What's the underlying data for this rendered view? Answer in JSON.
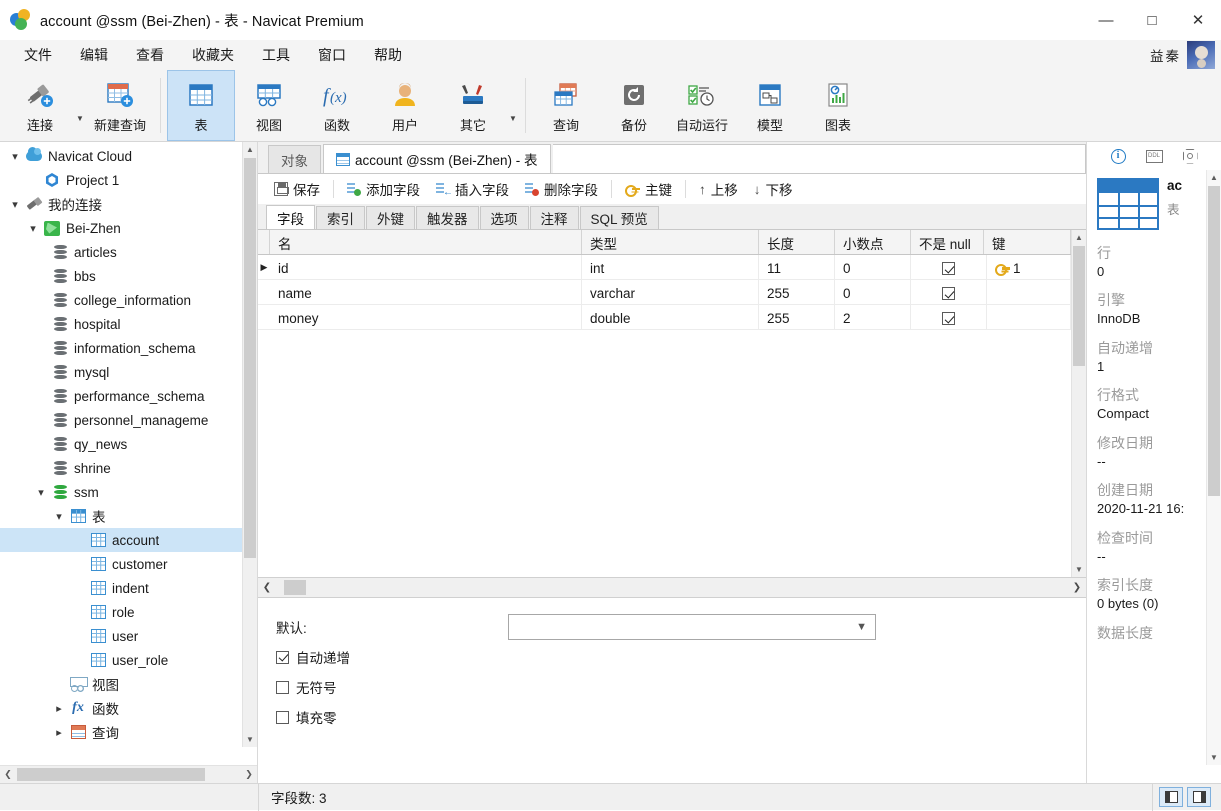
{
  "window": {
    "title": "account @ssm (Bei-Zhen) - 表 - Navicat Premium",
    "minimize": "—",
    "maximize": "□",
    "close": "✕"
  },
  "menubar": {
    "items": [
      "文件",
      "编辑",
      "查看",
      "收藏夹",
      "工具",
      "窗口",
      "帮助"
    ],
    "username": "益秦"
  },
  "ribbon": {
    "buttons": [
      {
        "label": "连接",
        "icon": "connection-icon",
        "caret": true
      },
      {
        "label": "新建查询",
        "icon": "new-query-icon",
        "caret": false
      },
      {
        "label": "表",
        "icon": "table-icon",
        "caret": false,
        "active": true
      },
      {
        "label": "视图",
        "icon": "view-icon",
        "caret": false
      },
      {
        "label": "函数",
        "icon": "function-icon",
        "caret": false
      },
      {
        "label": "用户",
        "icon": "user-icon",
        "caret": false
      },
      {
        "label": "其它",
        "icon": "other-icon",
        "caret": true
      },
      {
        "label": "查询",
        "icon": "query-icon",
        "caret": false
      },
      {
        "label": "备份",
        "icon": "backup-icon",
        "caret": false
      },
      {
        "label": "自动运行",
        "icon": "automation-icon",
        "caret": false
      },
      {
        "label": "模型",
        "icon": "model-icon",
        "caret": false
      },
      {
        "label": "图表",
        "icon": "chart-icon",
        "caret": false
      }
    ]
  },
  "sidebar": {
    "tree": [
      {
        "label": "Navicat Cloud",
        "indent": 0,
        "icon": "cloud-icon",
        "caret": "open"
      },
      {
        "label": "Project 1",
        "indent": 1,
        "icon": "project-icon",
        "caret": "none"
      },
      {
        "label": "我的连接",
        "indent": 0,
        "icon": "plug-icon",
        "caret": "open"
      },
      {
        "label": "Bei-Zhen",
        "indent": 1,
        "icon": "connection-icon",
        "caret": "open"
      },
      {
        "label": "articles",
        "indent": 2,
        "icon": "database-icon",
        "caret": "none"
      },
      {
        "label": "bbs",
        "indent": 2,
        "icon": "database-icon",
        "caret": "none"
      },
      {
        "label": "college_information",
        "indent": 2,
        "icon": "database-icon",
        "caret": "none"
      },
      {
        "label": "hospital",
        "indent": 2,
        "icon": "database-icon",
        "caret": "none"
      },
      {
        "label": "information_schema",
        "indent": 2,
        "icon": "database-icon",
        "caret": "none"
      },
      {
        "label": "mysql",
        "indent": 2,
        "icon": "database-icon",
        "caret": "none"
      },
      {
        "label": "performance_schema",
        "indent": 2,
        "icon": "database-icon",
        "caret": "none"
      },
      {
        "label": "personnel_manageme",
        "indent": 2,
        "icon": "database-icon",
        "caret": "none"
      },
      {
        "label": "qy_news",
        "indent": 2,
        "icon": "database-icon",
        "caret": "none"
      },
      {
        "label": "shrine",
        "indent": 2,
        "icon": "database-icon",
        "caret": "none"
      },
      {
        "label": "ssm",
        "indent": 2,
        "icon": "database-open-icon",
        "caret": "open"
      },
      {
        "label": "表",
        "indent": 3,
        "icon": "table-folder-icon",
        "caret": "open"
      },
      {
        "label": "account",
        "indent": 4,
        "icon": "table-icon",
        "caret": "none",
        "selected": true
      },
      {
        "label": "customer",
        "indent": 4,
        "icon": "table-icon",
        "caret": "none"
      },
      {
        "label": "indent",
        "indent": 4,
        "icon": "table-icon",
        "caret": "none"
      },
      {
        "label": "role",
        "indent": 4,
        "icon": "table-icon",
        "caret": "none"
      },
      {
        "label": "user",
        "indent": 4,
        "icon": "table-icon",
        "caret": "none"
      },
      {
        "label": "user_role",
        "indent": 4,
        "icon": "table-icon",
        "caret": "none"
      },
      {
        "label": "视图",
        "indent": 3,
        "icon": "view-icon",
        "caret": "none"
      },
      {
        "label": "函数",
        "indent": 3,
        "icon": "function-icon",
        "caret": "closed"
      },
      {
        "label": "查询",
        "indent": 3,
        "icon": "query-icon",
        "caret": "closed"
      }
    ]
  },
  "main": {
    "window_tabs": [
      {
        "label": "对象",
        "active": false
      },
      {
        "label": "account @ssm (Bei-Zhen) - 表",
        "active": true,
        "icon": "table-design-icon"
      }
    ],
    "toolbar": [
      {
        "label": "保存",
        "icon": "save-icon"
      },
      {
        "label": "添加字段",
        "icon": "add-field-icon"
      },
      {
        "label": "插入字段",
        "icon": "insert-field-icon"
      },
      {
        "label": "删除字段",
        "icon": "delete-field-icon"
      },
      {
        "label": "主键",
        "icon": "primary-key-icon"
      },
      {
        "label": "上移",
        "icon": "move-up-icon"
      },
      {
        "label": "下移",
        "icon": "move-down-icon"
      }
    ],
    "field_tabs": [
      {
        "label": "字段",
        "active": true
      },
      {
        "label": "索引",
        "active": false
      },
      {
        "label": "外键",
        "active": false
      },
      {
        "label": "触发器",
        "active": false
      },
      {
        "label": "选项",
        "active": false
      },
      {
        "label": "注释",
        "active": false
      },
      {
        "label": "SQL 预览",
        "active": false
      }
    ],
    "grid": {
      "columns": [
        "名",
        "类型",
        "长度",
        "小数点",
        "不是 null",
        "键"
      ],
      "rows": [
        {
          "name": "id",
          "type": "int",
          "length": "11",
          "decimals": "0",
          "not_null": true,
          "key": "1",
          "current": true
        },
        {
          "name": "name",
          "type": "varchar",
          "length": "255",
          "decimals": "0",
          "not_null": true,
          "key": "",
          "current": false
        },
        {
          "name": "money",
          "type": "double",
          "length": "255",
          "decimals": "2",
          "not_null": true,
          "key": "",
          "current": false
        }
      ]
    },
    "properties": {
      "default_label": "默认:",
      "default_value": "",
      "checkboxes": [
        {
          "label": "自动递增",
          "checked": true
        },
        {
          "label": "无符号",
          "checked": false
        },
        {
          "label": "填充零",
          "checked": false
        }
      ]
    }
  },
  "right_panel": {
    "tabs": [
      {
        "icon": "info-icon",
        "active": true
      },
      {
        "icon": "ddl-icon",
        "active": false,
        "glyph": "DDL"
      },
      {
        "icon": "gear-icon",
        "active": false
      }
    ],
    "object_name": "ac",
    "object_kind": "表",
    "items": [
      {
        "key": "行",
        "value": "0"
      },
      {
        "key": "引擎",
        "value": "InnoDB"
      },
      {
        "key": "自动递增",
        "value": "1"
      },
      {
        "key": "行格式",
        "value": "Compact"
      },
      {
        "key": "修改日期",
        "value": "--"
      },
      {
        "key": "创建日期",
        "value": "2020-11-21 16:"
      },
      {
        "key": "检查时间",
        "value": "--"
      },
      {
        "key": "索引长度",
        "value": "0 bytes (0)"
      },
      {
        "key": "数据长度",
        "value": ""
      }
    ]
  },
  "statusbar": {
    "field_count": "字段数: 3"
  },
  "colors": {
    "accent": "#2b79c2",
    "selection": "#cce4f7",
    "chrome": "#f4f4f4",
    "key_gold": "#e3a91b"
  }
}
